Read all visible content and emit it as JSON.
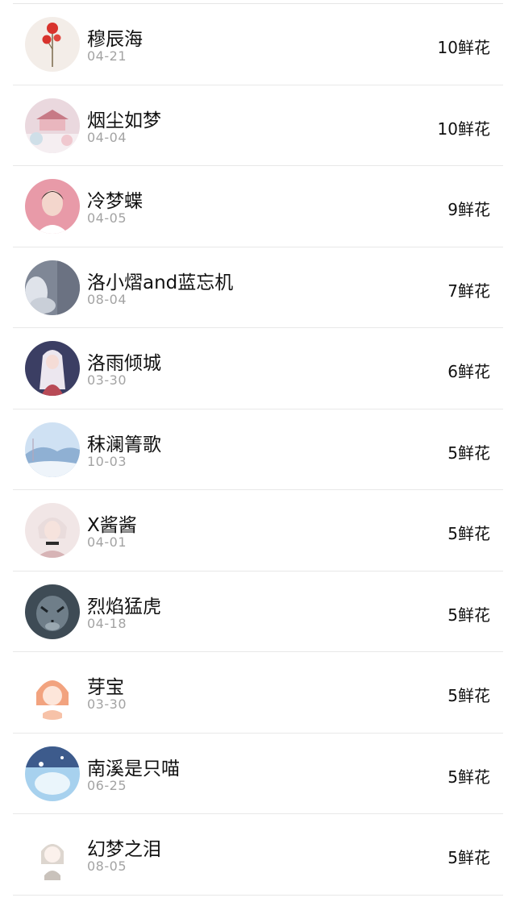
{
  "list": [
    {
      "name": "穆辰海",
      "date": "04-21",
      "flowers": "10鲜花",
      "avatar": {
        "bg": "#f3ede8",
        "accent": "#d8332d",
        "icon": "red-spider-lily"
      }
    },
    {
      "name": "烟尘如梦",
      "date": "04-04",
      "flowers": "10鲜花",
      "avatar": {
        "bg": "#ead8de",
        "accent": "#c77a86",
        "icon": "pavilion"
      }
    },
    {
      "name": "冷梦蝶",
      "date": "04-05",
      "flowers": "9鲜花",
      "avatar": {
        "bg": "#e89aa8",
        "accent": "#3a2a2a",
        "icon": "portrait-man"
      }
    },
    {
      "name": "洛小熠and蓝忘机",
      "date": "08-04",
      "flowers": "7鲜花",
      "avatar": {
        "bg": "#7f8796",
        "accent": "#dfe3ea",
        "icon": "cloudy-figure"
      }
    },
    {
      "name": "洛雨倾城",
      "date": "03-30",
      "flowers": "6鲜花",
      "avatar": {
        "bg": "#3b3e63",
        "accent": "#b84a56",
        "icon": "anime-girl"
      }
    },
    {
      "name": "秣澜箐歌",
      "date": "10-03",
      "flowers": "5鲜花",
      "avatar": {
        "bg": "#cfe1f3",
        "accent": "#8fb0d3",
        "icon": "snow-landscape"
      }
    },
    {
      "name": "X酱酱",
      "date": "04-01",
      "flowers": "5鲜花",
      "avatar": {
        "bg": "#f1e6e6",
        "accent": "#d7b4b6",
        "icon": "anime-boy"
      }
    },
    {
      "name": "烈焰猛虎",
      "date": "04-18",
      "flowers": "5鲜花",
      "avatar": {
        "bg": "#3e4b55",
        "accent": "#9aa8b1",
        "icon": "tiger"
      }
    },
    {
      "name": "芽宝",
      "date": "03-30",
      "flowers": "5鲜花",
      "avatar": {
        "bg": "#ffffff",
        "accent": "#f2a37f",
        "icon": "cartoon-girl"
      }
    },
    {
      "name": "南溪是只喵",
      "date": "06-25",
      "flowers": "5鲜花",
      "avatar": {
        "bg": "#a7d1ee",
        "accent": "#3d5b8c",
        "icon": "fantasy-scene"
      }
    },
    {
      "name": "幻梦之泪",
      "date": "08-05",
      "flowers": "5鲜花",
      "avatar": {
        "bg": "#ffffff",
        "accent": "#c9c2bb",
        "icon": "chibi-girl"
      }
    }
  ]
}
